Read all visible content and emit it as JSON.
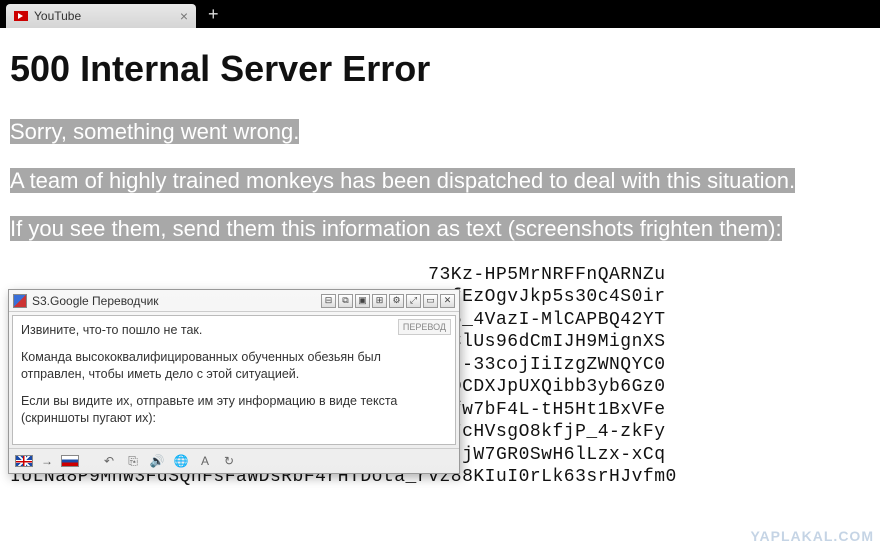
{
  "browser": {
    "tab_title": "YouTube",
    "new_tab": "+",
    "close": "×"
  },
  "error": {
    "heading": "500 Internal Server Error",
    "line1": "Sorry, something went wrong.",
    "line2": "A team of highly trained monkeys has been dispatched to deal with this situation.",
    "line3": "If you see them, send them this information as text (screenshots frighten them):",
    "code": "                                     73Kz-HP5MrNRFFnQARNZu\n                                     atfEzOgvJkp5s30c4S0ir\n                                     4r5_4VazI-MlCAPBQ42YT\n                                     I3ClUs96dCmIJH9MignXS\n                                     xjj-33cojIiIzgZWNQYC0\n                                     RRDCDXJpUXQibb3yb6Gz0\n                                     Zbfw7bF4L-tH5Ht1BxVFe\n                                     -E7cHVsgO8kfjP_4-zkFy\n                                     DWnjW7GR0SwH6lLzx-xCq\nIULNa8P9Mnw3FdSQnFsFaWDsRbF4rHTDota_rvz88KIuI0rLk63srHJvfm0"
  },
  "translator": {
    "title": "S3.Google Переводчик",
    "translate_tag": "ПЕРЕВОД",
    "p1": "Извините, что-то пошло не так.",
    "p2": "Команда высококвалифицированных обученных обезьян был отправлен, чтобы иметь дело с этой ситуацией.",
    "p3": "Если вы видите их, отправьте им эту информацию в виде текста (скриншоты пугают их):",
    "winbtns": [
      "⊟",
      "⧉",
      "▣",
      "⊞",
      "⚙",
      "⤢",
      "▭",
      "✕"
    ]
  },
  "watermark": "YAPLAKAL.COM"
}
